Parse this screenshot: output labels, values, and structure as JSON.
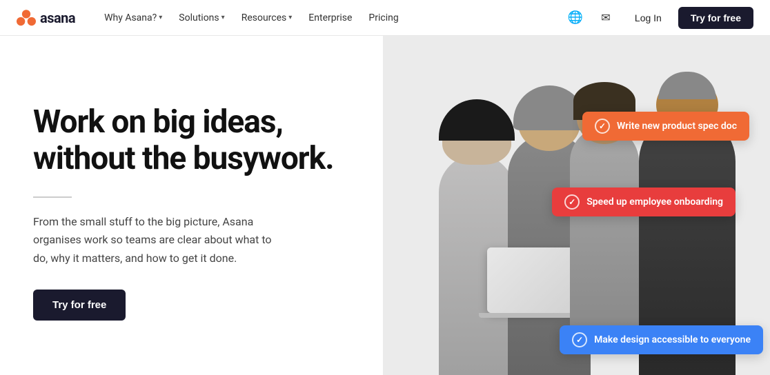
{
  "logo": {
    "text": "asana"
  },
  "nav": {
    "items": [
      {
        "label": "Why Asana?",
        "hasDropdown": true
      },
      {
        "label": "Solutions",
        "hasDropdown": true
      },
      {
        "label": "Resources",
        "hasDropdown": true
      },
      {
        "label": "Enterprise",
        "hasDropdown": false
      },
      {
        "label": "Pricing",
        "hasDropdown": false
      }
    ],
    "login_label": "Log In",
    "try_free_label": "Try for free"
  },
  "hero": {
    "title_line1": "Work on big ideas,",
    "title_line2": "without the busywork.",
    "subtitle": "From the small stuff to the big picture, Asana organises work so teams are clear about what to do, why it matters, and how to get it done.",
    "cta_label": "Try for free"
  },
  "badges": [
    {
      "id": "badge-1",
      "text": "Write new product spec doc",
      "color": "orange",
      "check": "✓"
    },
    {
      "id": "badge-2",
      "text": "Speed up employee onboarding",
      "color": "red",
      "check": "✓"
    },
    {
      "id": "badge-3",
      "text": "Make design accessible to everyone",
      "color": "blue",
      "check": "✓"
    }
  ],
  "colors": {
    "badge_orange": "#f06a35",
    "badge_red": "#e83d3d",
    "badge_blue": "#3b82f6",
    "nav_dark": "#1a1a2e",
    "cta_dark": "#1a1a2e"
  }
}
